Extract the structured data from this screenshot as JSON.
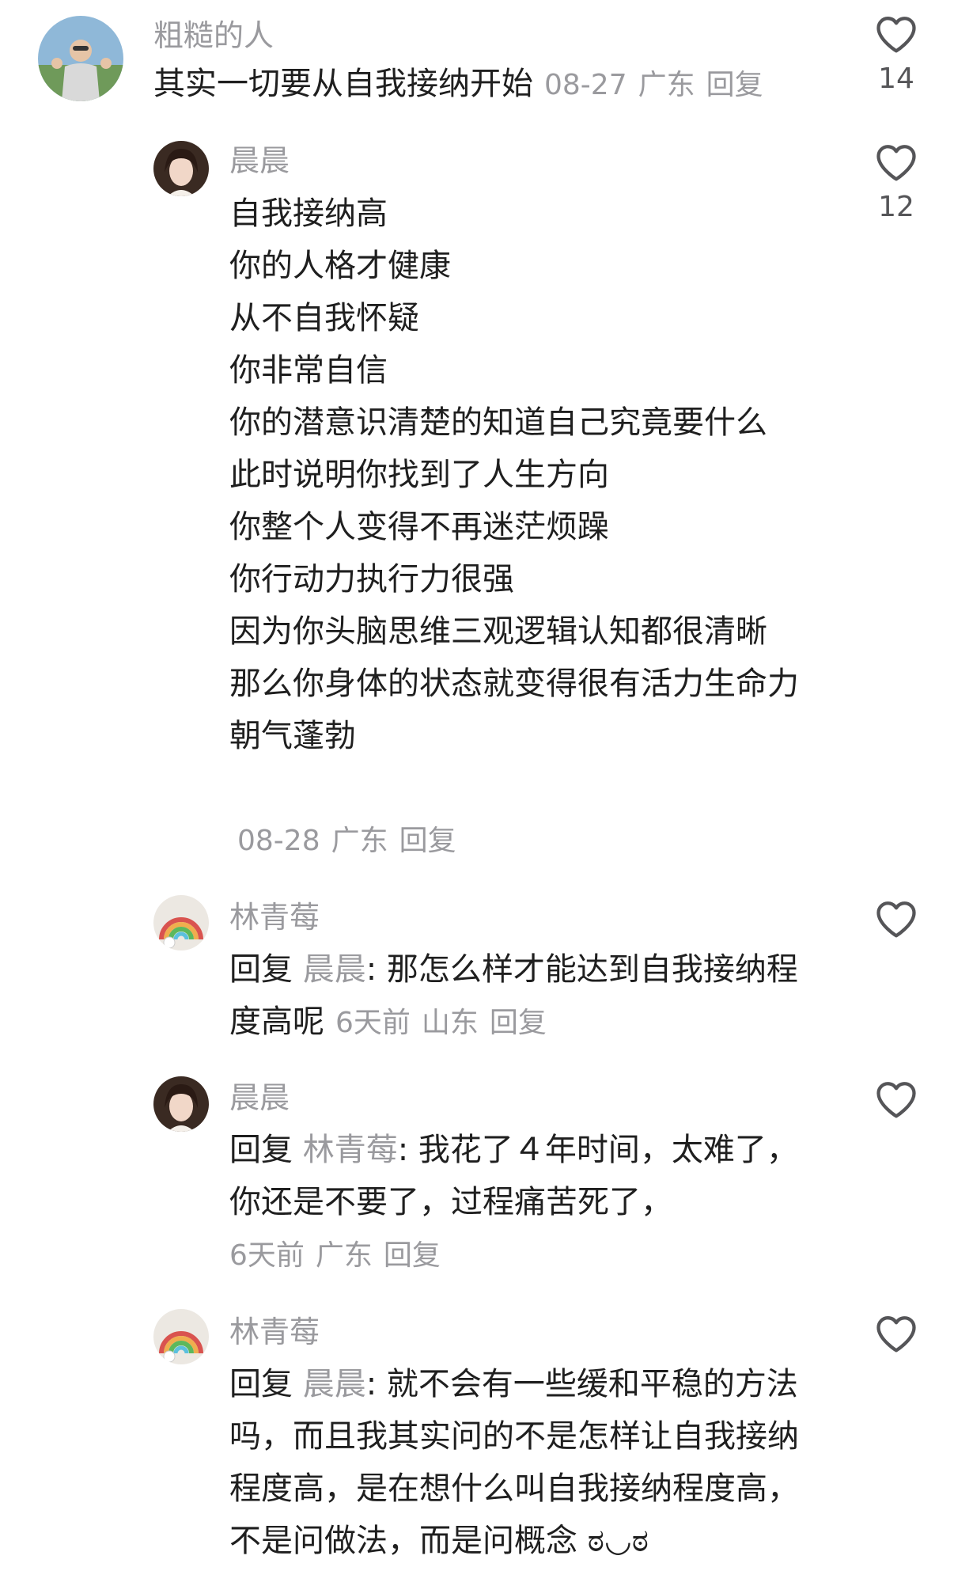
{
  "comments": [
    {
      "username": "粗糙的人",
      "text": "其实一切要从自我接纳开始",
      "date": "08-27",
      "location": "广东",
      "reply_label": "回复",
      "likes": "14"
    },
    {
      "username": "晨晨",
      "lines": [
        "自我接纳高",
        "你的人格才健康",
        "从不自我怀疑",
        "你非常自信",
        "你的潜意识清楚的知道自己究竟要什么",
        "此时说明你找到了人生方向",
        "你整个人变得不再迷茫烦躁",
        "你行动力执行力很强",
        "因为你头脑思维三观逻辑认知都很清晰",
        "那么你身体的状态就变得很有活力生命力",
        "朝气蓬勃"
      ],
      "date": "08-28",
      "location": "广东",
      "reply_label": "回复",
      "likes": "12"
    },
    {
      "username": "林青莓",
      "reply_prefix": "回复",
      "reply_to": "晨晨",
      "line1": "那怎么样才能达到自我接纳程",
      "line2": "度高呢",
      "date": "6天前",
      "location": "山东",
      "reply_label": "回复"
    },
    {
      "username": "晨晨",
      "reply_prefix": "回复",
      "reply_to": "林青莓",
      "line1": "我花了４年时间，太难了，",
      "line2": "你还是不要了，过程痛苦死了，",
      "date": "6天前",
      "location": "广东",
      "reply_label": "回复"
    },
    {
      "username": "林青莓",
      "reply_prefix": "回复",
      "reply_to": "晨晨",
      "line1": "就不会有一些缓和平稳的方法",
      "line2": "吗，而且我其实问的不是怎样让自我接纳",
      "line3": "程度高，是在想什么叫自我接纳程度高，",
      "line4": "不是问做法，而是问概念",
      "emoji": "ಠ◡ಠ"
    }
  ],
  "icons": {
    "like": "heart-outline-icon"
  },
  "colors": {
    "text": "#1f1f1f",
    "muted": "#9a9a9e",
    "background": "#ffffff"
  }
}
